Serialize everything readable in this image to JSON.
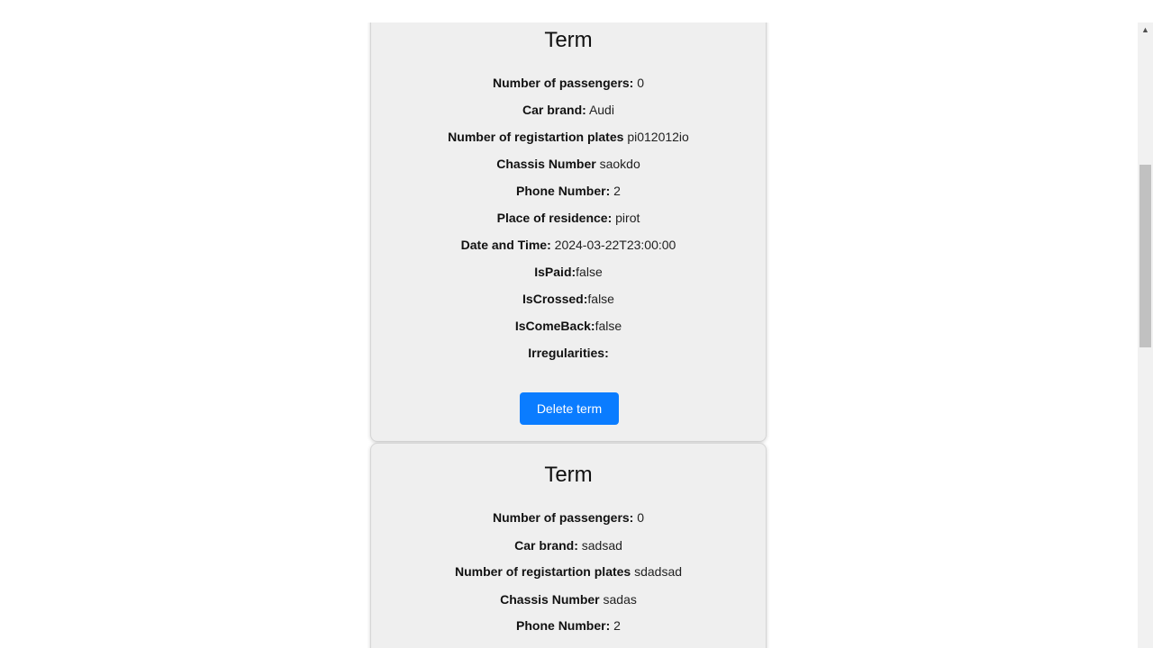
{
  "cards": [
    {
      "title": "Term",
      "fields": [
        {
          "label": "Number of passengers:",
          "value": "0"
        },
        {
          "label": "Car brand:",
          "value": "Audi"
        },
        {
          "label": "Number of registartion plates",
          "value": "pi012012io"
        },
        {
          "label": "Chassis Number",
          "value": "saokdo"
        },
        {
          "label": "Phone Number:",
          "value": "2"
        },
        {
          "label": "Place of residence:",
          "value": "pirot"
        },
        {
          "label": "Date and Time:",
          "value": "2024-03-22T23:00:00"
        },
        {
          "label": "IsPaid:",
          "value": "false"
        },
        {
          "label": "IsCrossed:",
          "value": "false"
        },
        {
          "label": "IsComeBack:",
          "value": "false"
        },
        {
          "label": "Irregularities:",
          "value": ""
        }
      ],
      "button_label": "Delete term"
    },
    {
      "title": "Term",
      "fields": [
        {
          "label": "Number of passengers:",
          "value": "0"
        },
        {
          "label": "Car brand:",
          "value": "sadsad"
        },
        {
          "label": "Number of registartion plates",
          "value": "sdadsad"
        },
        {
          "label": "Chassis Number",
          "value": "sadas"
        },
        {
          "label": "Phone Number:",
          "value": "2"
        }
      ]
    }
  ],
  "scrollbar": {
    "up_arrow_icon": "triangle-up-icon"
  }
}
